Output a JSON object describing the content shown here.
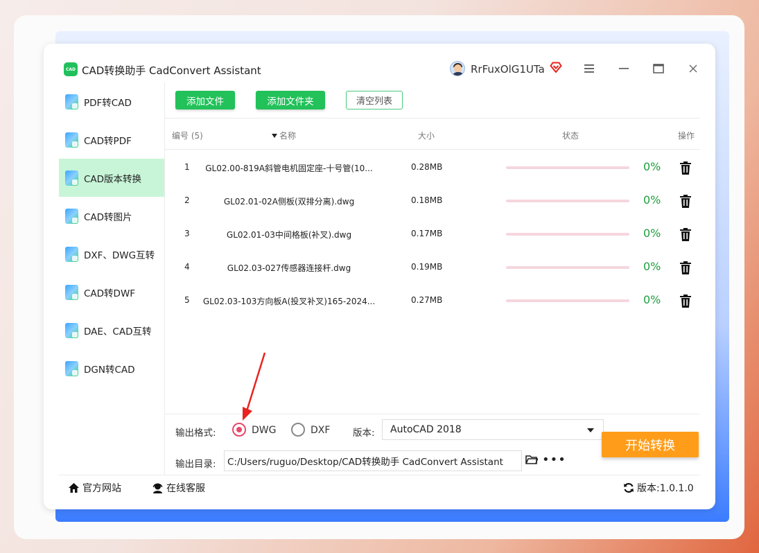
{
  "app": {
    "logo_text": "CAD",
    "title": "CAD转换助手 CadConvert Assistant",
    "username": "RrFuxOlG1UTa"
  },
  "sidebar": {
    "items": [
      {
        "label": "PDF转CAD",
        "active": false
      },
      {
        "label": "CAD转PDF",
        "active": false
      },
      {
        "label": "CAD版本转换",
        "active": true
      },
      {
        "label": "CAD转图片",
        "active": false
      },
      {
        "label": "DXF、DWG互转",
        "active": false
      },
      {
        "label": "CAD转DWF",
        "active": false
      },
      {
        "label": "DAE、CAD互转",
        "active": false
      },
      {
        "label": "DGN转CAD",
        "active": false
      }
    ]
  },
  "toolbar": {
    "add_file": "添加文件",
    "add_folder": "添加文件夹",
    "clear_list": "清空列表"
  },
  "table": {
    "headers": {
      "num": "编号 (5)",
      "name": "名称",
      "size": "大小",
      "status": "状态",
      "op": "操作"
    },
    "rows": [
      {
        "num": "1",
        "name": "GL02.00-819A斜管电机固定座-十号管(10...",
        "size": "0.28MB",
        "progress": "0%"
      },
      {
        "num": "2",
        "name": "GL02.01-02A侧板(双排分离).dwg",
        "size": "0.18MB",
        "progress": "0%"
      },
      {
        "num": "3",
        "name": "GL02.01-03中间格板(补叉).dwg",
        "size": "0.17MB",
        "progress": "0%"
      },
      {
        "num": "4",
        "name": "GL02.03-027传感器连接杆.dwg",
        "size": "0.19MB",
        "progress": "0%"
      },
      {
        "num": "5",
        "name": "GL02.03-103方向板A(投叉补叉)165-2024...",
        "size": "0.27MB",
        "progress": "0%"
      }
    ]
  },
  "output": {
    "format_label": "输出格式:",
    "format_options": [
      "DWG",
      "DXF"
    ],
    "format_selected": "DWG",
    "version_label": "版本:",
    "version_value": "AutoCAD 2018",
    "dir_label": "输出目录:",
    "dir_value": "C:/Users/ruguo/Desktop/CAD转换助手 CadConvert Assistant",
    "start_button": "开始转换"
  },
  "footer": {
    "website": "官方网站",
    "support": "在线客服",
    "version": "版本:1.0.1.0"
  },
  "colors": {
    "accent_green": "#22c15a",
    "active_bg": "#c8f5d8",
    "start_orange": "#ff9d1a",
    "progress_pink": "#f6d6de",
    "percent_green": "#1f9e3f",
    "annotation_red": "#e8231f"
  }
}
